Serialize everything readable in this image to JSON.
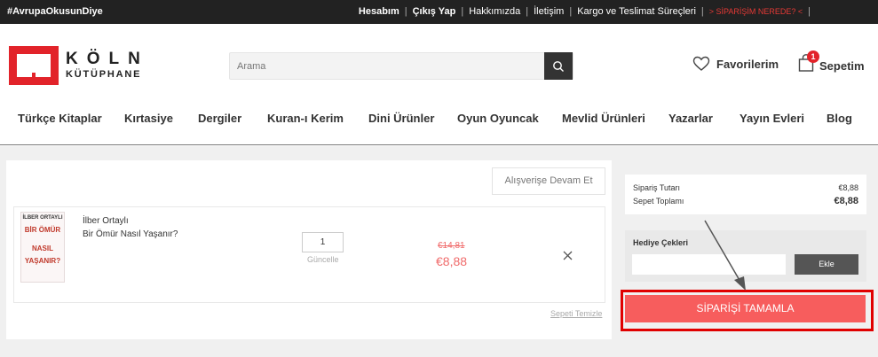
{
  "topbar": {
    "hashtag": "#AvrupaOkusunDiye",
    "links": [
      "Hesabım",
      "Çıkış Yap",
      "Hakkımızda",
      "İletişim",
      "Kargo ve Teslimat Süreçleri",
      "> SİPARİŞİM NEREDE? <"
    ]
  },
  "logo": {
    "word1": "KÖLN",
    "word2": "KÜTÜPHANE"
  },
  "search": {
    "placeholder": "Arama",
    "icon": "search-icon"
  },
  "header": {
    "favorites": "Favorilerim",
    "cart": "Sepetim",
    "cart_count": "1"
  },
  "nav": [
    "Türkçe Kitaplar",
    "Kırtasiye",
    "Dergiler",
    "Kuran-ı Kerim",
    "Dini Ürünler",
    "Oyun Oyuncak",
    "Mevlid Ürünleri",
    "Yazarlar",
    "Yayın Evleri",
    "Blog"
  ],
  "cart": {
    "continue": "Alışverişe Devam Et",
    "item": {
      "author": "İlber Ortaylı",
      "title": "Bir Ömür Nasıl Yaşanır?",
      "cover_lines": [
        "İLBER ORTAYLI",
        "BİR ÖMÜR",
        "NASIL",
        "YAŞANIR?"
      ],
      "quantity": "1",
      "update": "Güncelle",
      "old_price": "€14,81",
      "price": "€8,88"
    },
    "clear": "Sepeti Temizle"
  },
  "summary": {
    "order_label": "Sipariş Tutarı",
    "order_value": "€8,88",
    "total_label": "Sepet Toplamı",
    "total_value": "€8,88"
  },
  "gift": {
    "label": "Hediye Çekleri",
    "button": "Ekle"
  },
  "complete": "SİPARİŞİ TAMAMLA",
  "colors": {
    "brand": "#e2232a",
    "price": "#f06b6b",
    "cta": "#f75d5d",
    "highlight": "#e00000",
    "topbar": "#222222"
  }
}
